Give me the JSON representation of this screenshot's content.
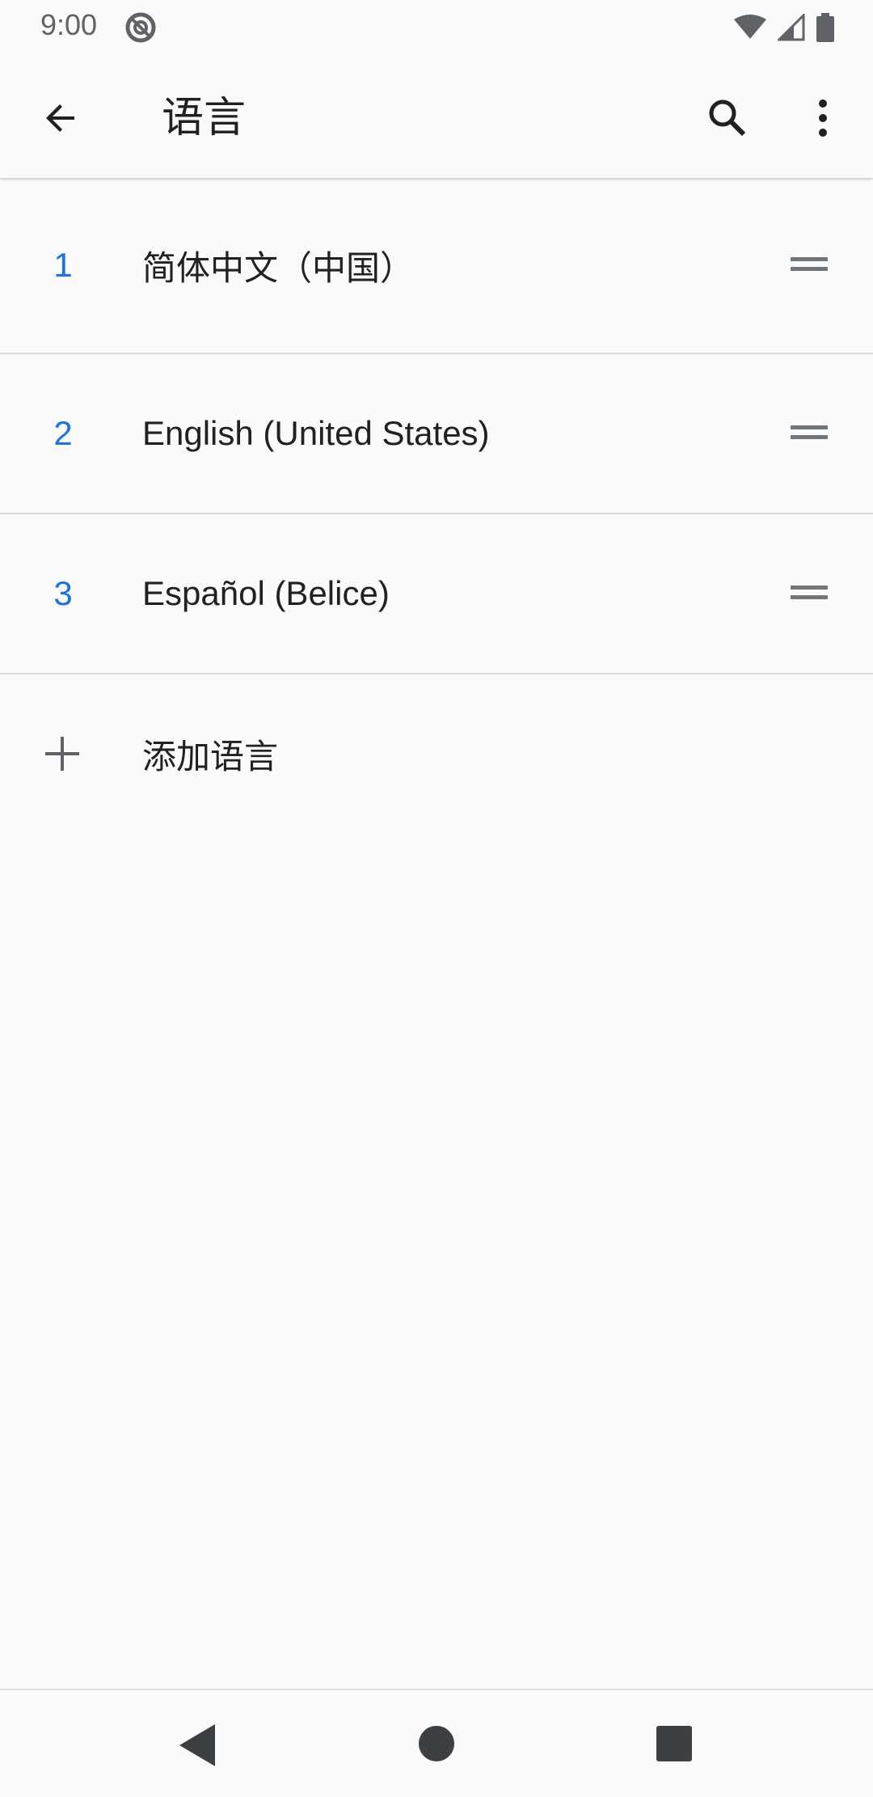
{
  "status_bar": {
    "time": "9:00"
  },
  "app_bar": {
    "title": "语言"
  },
  "languages": [
    {
      "index": "1",
      "label": "简体中文（中国）"
    },
    {
      "index": "2",
      "label": "English (United States)"
    },
    {
      "index": "3",
      "label": "Español (Belice)"
    }
  ],
  "add_language": {
    "label": "添加语言"
  },
  "colors": {
    "accent": "#1a73e8",
    "text": "#202124",
    "background": "#fafafa",
    "divider": "#dadce0"
  },
  "icons": {
    "back": "arrow-back-icon",
    "search": "search-icon",
    "more": "more-vert-icon",
    "drag": "drag-handle-icon",
    "add": "plus-icon"
  }
}
